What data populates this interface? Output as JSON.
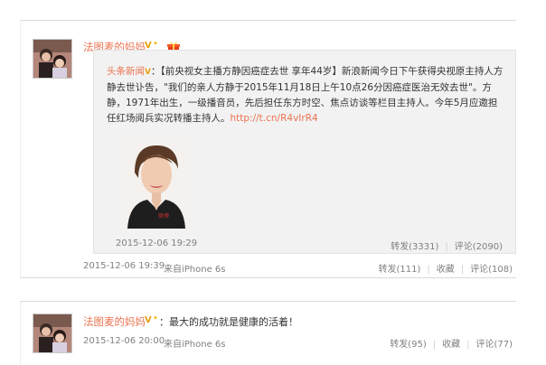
{
  "post1": {
    "username": "法图麦的妈妈",
    "repost": {
      "source_user": "头条新闻",
      "text": "：【前央视女主播方静因癌症去世 享年44岁】新浪新闻今日下午获得央视原主持人方静去世讣告，\"我们的亲人方静于2015年11月18日上午10点26分因癌症医治无效去世\"。方静，1971年出生，一级播音员，先后担任东方时空、焦点访谈等栏目主持人。今年5月应邀担任红场阅兵实况转播主持人。",
      "link": "http://t.cn/R4vIrR4",
      "time": "2015-12-06 19:29",
      "forward": "转发(3331)",
      "comment": "评论(2090)"
    },
    "time": "2015-12-06 19:39",
    "source": "来自iPhone 6s",
    "forward": "转发(111)",
    "favorite": "收藏",
    "comment": "评论(108)"
  },
  "post2": {
    "username": "法图麦的妈妈",
    "text": "：最大的成功就是健康的活着！",
    "time": "2015-12-06 20:00",
    "source": "来自iPhone 6s",
    "forward": "转发(95)",
    "favorite": "收藏",
    "comment": "评论(77)"
  },
  "icons": {
    "verified": "v-badge-icon",
    "gift": "gift-icon",
    "repost_verified": "v-badge-icon"
  },
  "colors": {
    "username": "#eb7350",
    "meta": "#808080",
    "repost_bg": "#f2f2f2"
  }
}
